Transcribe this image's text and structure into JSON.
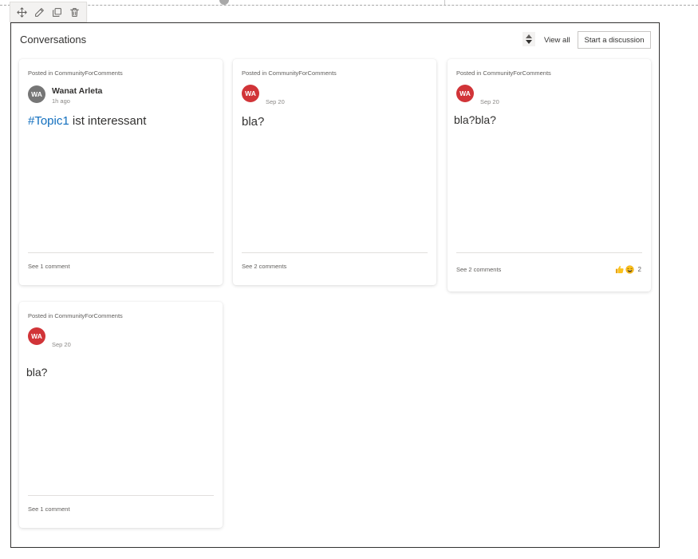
{
  "toolbar": {
    "icons": [
      "move-icon",
      "edit-icon",
      "duplicate-icon",
      "delete-icon"
    ]
  },
  "webpart": {
    "title": "Conversations",
    "view_all_label": "View all",
    "start_label": "Start a discussion"
  },
  "colors": {
    "avatar_grey": "#767676",
    "avatar_red": "#d13438",
    "hashtag": "#106ebe"
  },
  "cards": [
    {
      "posted": "Posted in CommunityForComments",
      "initials": "WA",
      "author": "Wanat Arleta",
      "time": "1h ago",
      "hashtag": "#Topic1",
      "body": " ist interessant",
      "comments": "See 1 comment"
    },
    {
      "posted": "Posted in CommunityForComments",
      "initials": "WA",
      "time": "Sep 20",
      "body": "bla?",
      "comments": "See 2 comments"
    },
    {
      "posted": "Posted in CommunityForComments",
      "initials": "WA",
      "time": "Sep 20",
      "body": "bla?bla?",
      "comments": "See 2 comments",
      "reaction_count": "2"
    },
    {
      "posted": "Posted in CommunityForComments",
      "initials": "WA",
      "time": "Sep 20",
      "body": "bla?",
      "comments": "See 1 comment"
    }
  ]
}
